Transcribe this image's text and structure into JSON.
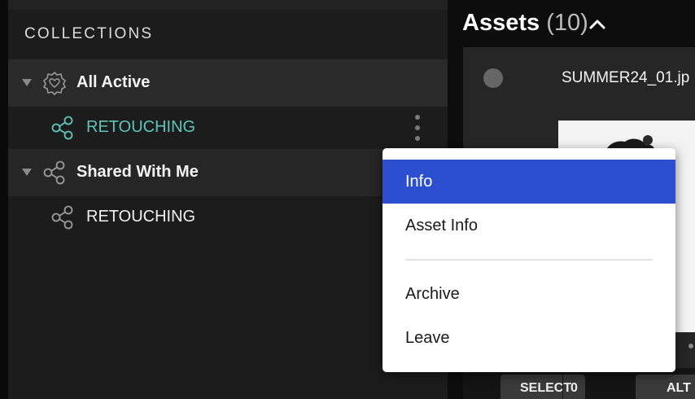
{
  "sidebar": {
    "section_title": "COLLECTIONS",
    "items": [
      {
        "label": "All Active",
        "icon": "heart-badge-icon",
        "expanded": true
      },
      {
        "label": "RETOUCHING",
        "icon": "share-icon",
        "active": true
      },
      {
        "label": "Shared With Me",
        "icon": "share-icon",
        "expanded": true
      },
      {
        "label": "RETOUCHING",
        "icon": "share-icon",
        "active": false
      }
    ]
  },
  "assets": {
    "title": "Assets",
    "count": "(10)",
    "card": {
      "filename": "SUMMER24_01.jp"
    },
    "select_label": "SELECT",
    "select_count": "0",
    "alt_label": "ALT"
  },
  "context_menu": {
    "items": [
      {
        "label": "Info",
        "selected": true
      },
      {
        "label": "Asset Info"
      },
      {
        "label": "Archive"
      },
      {
        "label": "Leave"
      }
    ]
  },
  "colors": {
    "accent_teal": "#5ec5b8",
    "menu_selected": "#2b4fce",
    "sidebar_bg": "#1c1c1c"
  }
}
